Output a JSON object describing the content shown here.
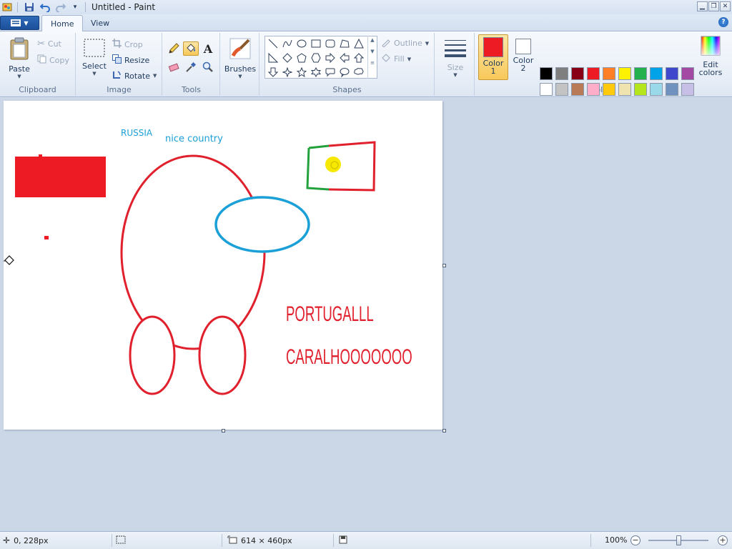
{
  "window": {
    "title": "Untitled - Paint",
    "minimize_icon": "minimize-icon",
    "maximize_icon": "restore-icon",
    "close_icon": "close-icon"
  },
  "tabs": [
    {
      "label": "Home",
      "active": true
    },
    {
      "label": "View",
      "active": false
    }
  ],
  "ribbon": {
    "clipboard": {
      "group": "Clipboard",
      "paste": "Paste",
      "cut": "Cut",
      "copy": "Copy"
    },
    "image": {
      "group": "Image",
      "select": "Select",
      "crop": "Crop",
      "resize": "Resize",
      "rotate": "Rotate"
    },
    "tools": {
      "group": "Tools"
    },
    "brushes": {
      "label": "Brushes"
    },
    "shapes": {
      "group": "Shapes",
      "outline": "Outline",
      "fill": "Fill"
    },
    "size": {
      "label": "Size"
    },
    "colors": {
      "group": "Colors",
      "color1_label": "Color",
      "color1_num": "1",
      "color2_label": "Color",
      "color2_num": "2",
      "edit_label": "Edit",
      "edit_label2": "colors",
      "color1": "#ed1c24",
      "color2": "#ffffff",
      "palette_row1": [
        "#000000",
        "#7f7f7f",
        "#880015",
        "#ed1c24",
        "#ff7f27",
        "#fff200",
        "#22b14c",
        "#00a2e8",
        "#3f48cc",
        "#a349a4"
      ],
      "palette_row2": [
        "#ffffff",
        "#c3c3c3",
        "#b97a57",
        "#ffaec9",
        "#ffc90e",
        "#efe4b0",
        "#b5e61d",
        "#99d9ea",
        "#7092be",
        "#c8bfe7"
      ]
    }
  },
  "canvas": {
    "texts": {
      "russia": "RUSSIA",
      "nice": "nice country",
      "portugal": "PORTUGALLL",
      "caralho": "CARALHOOOOOOO"
    }
  },
  "status": {
    "cursor_pos": "0, 228px",
    "canvas_size": "614 × 460px",
    "zoom": "100%"
  }
}
